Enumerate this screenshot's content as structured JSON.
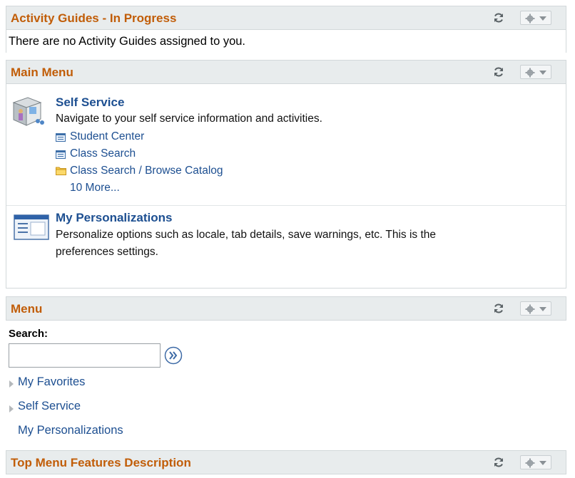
{
  "activity_guides": {
    "title": "Activity Guides - In Progress",
    "message": "There are no Activity Guides assigned to you."
  },
  "main_menu": {
    "title": "Main Menu",
    "self_service": {
      "heading": "Self Service",
      "description": "Navigate to your self service information and activities.",
      "links": [
        {
          "label": "Student Center",
          "icon": "document-list-icon"
        },
        {
          "label": "Class Search",
          "icon": "document-list-icon"
        },
        {
          "label": "Class Search / Browse Catalog",
          "icon": "folder-icon"
        }
      ],
      "more": "10 More..."
    },
    "personalizations": {
      "heading": "My Personalizations",
      "description_line1": "Personalize options such as locale, tab details, save warnings, etc. This is the",
      "description_line2": "preferences settings."
    }
  },
  "menu": {
    "title": "Menu",
    "search_label": "Search:",
    "search_value": "",
    "items": [
      {
        "label": "My Favorites",
        "expandable": true
      },
      {
        "label": "Self Service",
        "expandable": true
      },
      {
        "label": "My Personalizations",
        "expandable": false
      }
    ]
  },
  "top_menu": {
    "title": "Top Menu Features Description"
  },
  "colors": {
    "header_title": "#c15d08",
    "link": "#1d4f91",
    "header_bg": "#e8eced"
  }
}
